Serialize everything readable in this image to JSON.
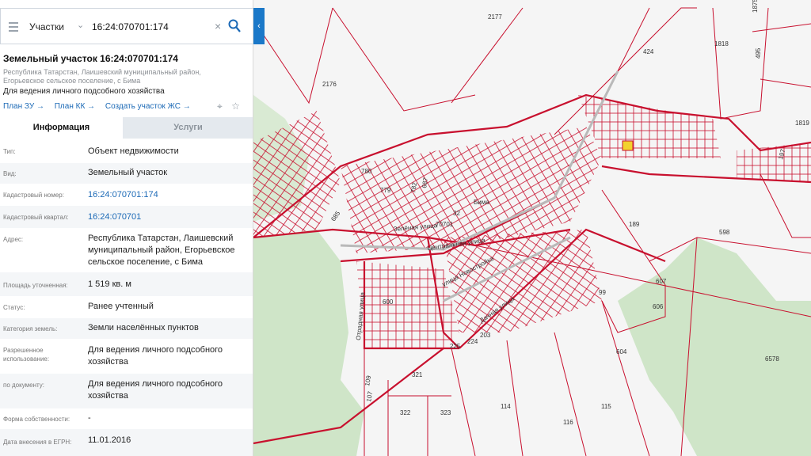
{
  "search": {
    "scope": "Участки",
    "query": "16:24:070701:174"
  },
  "parcel": {
    "title": "Земельный участок 16:24:070701:174",
    "address_short": "Республика Татарстан, Лаишевский муниципальный район, Егорьевское сельское поселение, с Бима",
    "purpose": "Для ведения личного подсобного хозяйства"
  },
  "actions": {
    "plan_zu": "План ЗУ →",
    "plan_kk": "План КК →",
    "create_zs": "Создать участок ЖС →"
  },
  "tabs": {
    "info": "Информация",
    "services": "Услуги"
  },
  "rows": [
    {
      "label": "Тип:",
      "value": "Объект недвижимости"
    },
    {
      "label": "Вид:",
      "value": "Земельный участок"
    },
    {
      "label": "Кадастровый номер:",
      "value": "16:24:070701:174"
    },
    {
      "label": "Кадастровый квартал:",
      "value": "16:24:070701"
    },
    {
      "label": "Адрес:",
      "value": "Республика Татарстан, Лаишевский муниципальный район, Егорьевское сельское поселение, с Бима"
    },
    {
      "label": "Площадь уточненная:",
      "value": "1 519 кв. м"
    },
    {
      "label": "Статус:",
      "value": "Ранее учтенный"
    },
    {
      "label": "Категория земель:",
      "value": "Земли населённых пунктов"
    },
    {
      "label": "Разрешенное использование:",
      "value": "Для ведения личного подсобного хозяйства"
    },
    {
      "label": "по документу:",
      "value": "Для ведения личного подсобного хозяйства"
    },
    {
      "label": "Форма собственности:",
      "value": "-"
    },
    {
      "label": "Дата внесения в ЕГРН:",
      "value": "11.01.2016"
    }
  ],
  "map": {
    "village": "Бима",
    "streets": [
      "Зелёная улица",
      "Центральная улица",
      "улица Новостройка",
      "Дачная улица",
      "Отрадная улица"
    ],
    "parcel_numbers": [
      "2177",
      "1875",
      "424",
      "1818",
      "495",
      "2176",
      "1819",
      "780",
      "779",
      "687",
      "782",
      "685",
      "189",
      "598",
      "197",
      "607",
      "606",
      "604",
      "6578",
      "99",
      "600",
      "321",
      "109",
      "107",
      "322",
      "323",
      "225",
      "224",
      "203",
      "114",
      "115",
      "116",
      "32",
      "70701"
    ],
    "colors": {
      "background": "#f5f5f5",
      "forest": "#cfe5c8",
      "boundary": "#c8102e",
      "selected": "#f2d22e"
    }
  }
}
